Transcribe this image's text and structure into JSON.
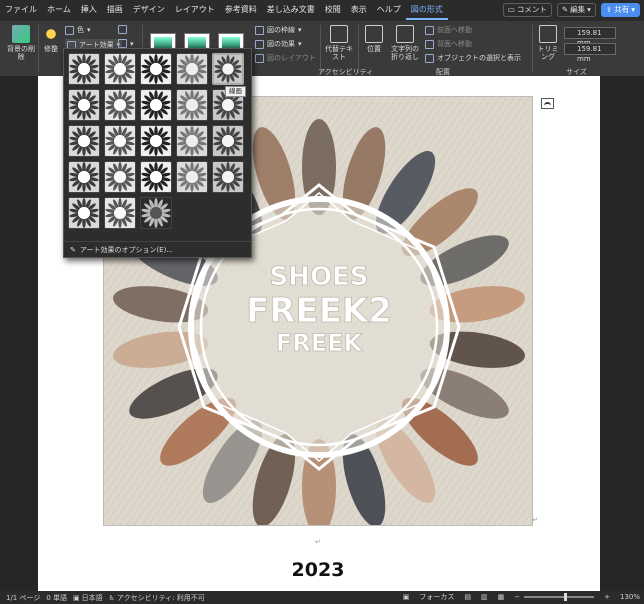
{
  "menu": {
    "tabs": [
      "ファイル",
      "ホーム",
      "挿入",
      "描画",
      "デザイン",
      "レイアウト",
      "参考資料",
      "差し込み文書",
      "校閲",
      "表示",
      "ヘルプ",
      "図の形式"
    ],
    "active_tab": "図の形式",
    "comment": "コメント",
    "edit": "編集",
    "share": "共有"
  },
  "ribbon": {
    "remove_bg": "背景の削除",
    "corrections": "修整",
    "color": "色",
    "art_effects": "アート効果",
    "picture_border": "図の枠線",
    "picture_effects": "図の効果",
    "picture_layout": "図のレイアウト",
    "alt_text": "代替テキスト",
    "accessibility": "アクセシビリティ",
    "position": "位置",
    "wrap_text": "文字列の折り返し",
    "bring_forward": "前面へ移動",
    "send_backward": "背面へ移動",
    "selection_pane": "オブジェクトの選択と表示",
    "arrange": "配置",
    "crop": "トリミング",
    "height": "159.81 mm",
    "width": "159.81 mm",
    "size": "サイズ"
  },
  "art_panel": {
    "tooltip": "線画",
    "options_label": "アート効果のオプション(E)...",
    "rows": [
      [
        "none",
        "effect",
        "effect",
        "effect",
        "effect-selected"
      ],
      [
        "effect",
        "effect",
        "effect",
        "effect",
        "effect"
      ],
      [
        "effect",
        "effect",
        "effect",
        "effect",
        "effect"
      ],
      [
        "effect",
        "effect",
        "effect",
        "effect",
        "effect"
      ],
      [
        "effect",
        "effect",
        "effect"
      ]
    ]
  },
  "document": {
    "year": "2023",
    "logo_lines": [
      "SHOES",
      "FREEK2",
      "FREEK"
    ]
  },
  "statusbar": {
    "page": "1/1 ページ",
    "words": "0 単語",
    "language": "日本語",
    "accessibility": "アクセシビリティ: 利用不可",
    "focus": "フォーカス",
    "zoom": "130%",
    "zoom_level": 0.6
  }
}
